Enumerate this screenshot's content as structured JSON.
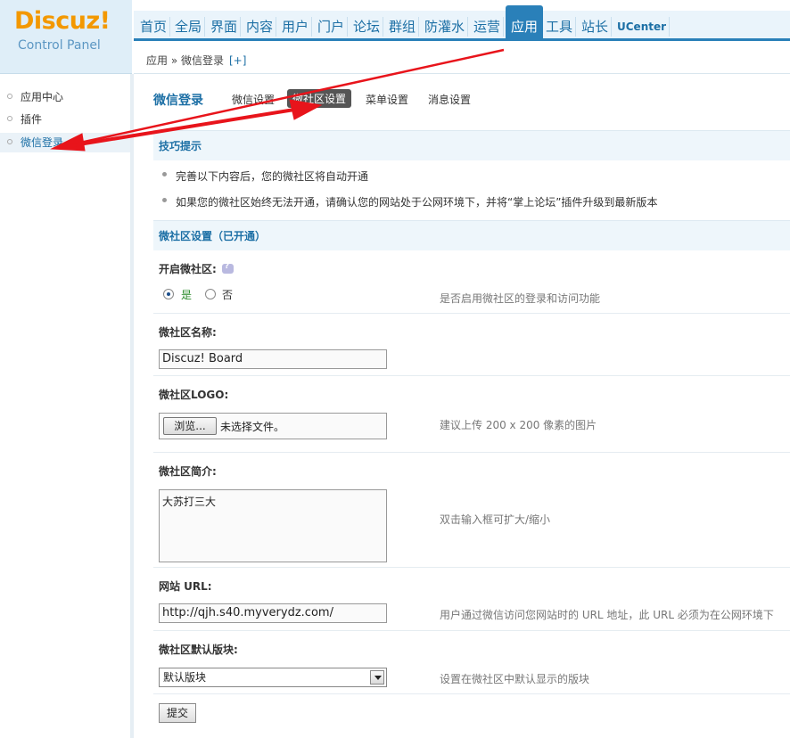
{
  "header": {
    "logo_main": "Discuz!",
    "logo_sub": "Control Panel",
    "nav": [
      "首页",
      "全局",
      "界面",
      "内容",
      "用户",
      "门户",
      "论坛",
      "群组",
      "防灌水",
      "运营",
      "应用",
      "工具",
      "站长",
      "UCenter"
    ],
    "active_nav_index": 10,
    "breadcrumb": "应用 » 微信登录",
    "breadcrumb_plus": "[+]"
  },
  "sidebar": {
    "items": [
      {
        "label": "应用中心"
      },
      {
        "label": "插件"
      },
      {
        "label": "微信登录"
      }
    ],
    "active_index": 2
  },
  "tabs": {
    "title": "微信登录",
    "items": [
      "微信设置",
      "微社区设置",
      "菜单设置",
      "消息设置"
    ],
    "active_index": 1
  },
  "tips": {
    "heading": "技巧提示",
    "items": [
      "完善以下内容后，您的微社区将自动开通",
      "如果您的微社区始终无法开通，请确认您的网站处于公网环境下，并将“掌上论坛”插件升级到最新版本"
    ]
  },
  "form": {
    "heading": "微社区设置（已开通）",
    "enable": {
      "label": "开启微社区:",
      "yes": "是",
      "no": "否",
      "selected": "yes",
      "help": "是否启用微社区的登录和访问功能"
    },
    "name": {
      "label": "微社区名称:",
      "value": "Discuz! Board"
    },
    "logo": {
      "label": "微社区LOGO:",
      "browse": "浏览...",
      "no_file": "未选择文件。",
      "help": "建议上传 200 x 200 像素的图片"
    },
    "intro": {
      "label": "微社区简介:",
      "value": "大苏打三大",
      "help": "双击输入框可扩大/缩小"
    },
    "url": {
      "label": "网站 URL:",
      "value": "http://qjh.s40.myverydz.com/",
      "help": "用户通过微信访问您网站时的 URL 地址，此 URL 必须为在公网环境下"
    },
    "forum": {
      "label": "微社区默认版块:",
      "value": "默认版块",
      "help": "设置在微社区中默认显示的版块"
    },
    "submit": "提交"
  },
  "colors": {
    "accent": "#2a80b9",
    "logo_orange": "#f39800",
    "annotation_red": "#e8141b"
  }
}
